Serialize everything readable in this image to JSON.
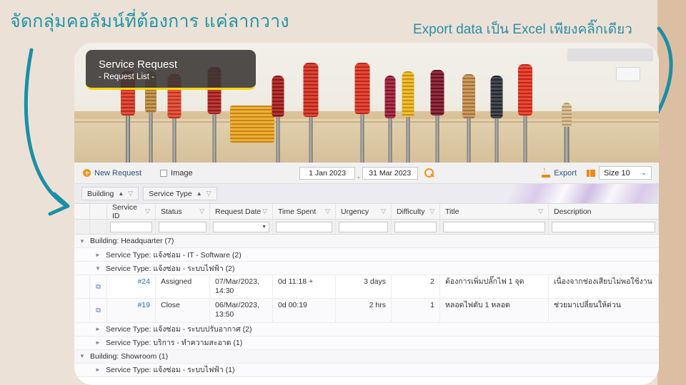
{
  "annotations": {
    "left_heading": "จัดกลุ่มคอลัมน์ที่ต้องการ แค่ลากวาง",
    "right_heading": "Export data เป็น Excel เพียงคลิ๊กเดียว",
    "accent_color": "#2196a8"
  },
  "hero": {
    "title": "Service Request",
    "subtitle": "- Request List -",
    "accent_underline": "#f5d60a"
  },
  "toolbar": {
    "new_request_label": "New Request",
    "new_request_icon": "plus-circle-icon",
    "image_checkbox_label": "Image",
    "image_checked": false,
    "date_from": "1 Jan 2023",
    "date_separator": "-",
    "date_to": "31 Mar 2023",
    "search_icon": "search-icon",
    "export_label": "Export",
    "export_icon": "export-icon",
    "size_icon": "list-size-icon",
    "size_value": "Size 10",
    "size_caret": "chevron-down-icon"
  },
  "group_chips": [
    {
      "label": "Building",
      "sort": "asc",
      "sort_icon": "sort-ascending-icon",
      "filter_icon": "filter-icon"
    },
    {
      "label": "Service Type",
      "sort": "asc",
      "sort_icon": "sort-ascending-icon",
      "filter_icon": "filter-icon"
    }
  ],
  "grid": {
    "columns": [
      {
        "label": "Service ID",
        "filter_icon": "filter-icon"
      },
      {
        "label": "Status",
        "filter_icon": "filter-icon"
      },
      {
        "label": "Request Date",
        "filter_icon": "filter-icon"
      },
      {
        "label": "Time Spent",
        "filter_icon": "filter-icon"
      },
      {
        "label": "Urgency",
        "filter_icon": "filter-icon"
      },
      {
        "label": "Difficulty",
        "filter_icon": "filter-icon"
      },
      {
        "label": "Title",
        "filter_icon": "filter-icon"
      },
      {
        "label": "Description",
        "filter_icon": ""
      }
    ],
    "filter_row": {
      "service_id": "",
      "status": "",
      "request_date": "",
      "time_spent": "",
      "urgency": "",
      "difficulty": "",
      "title": "",
      "description": ""
    },
    "groups": [
      {
        "level": 0,
        "expanded": true,
        "label": "Building: Headquarter (7)"
      },
      {
        "level": 1,
        "expanded": false,
        "label": "Service Type: แจ้งซ่อม - IT - Software (2)"
      },
      {
        "level": 1,
        "expanded": true,
        "label": "Service Type: แจ้งซ่อม - ระบบไฟฟ้า (2)"
      },
      {
        "level": 1,
        "expanded": false,
        "label": "Service Type: แจ้งซ่อม - ระบบปรับอากาศ (2)"
      },
      {
        "level": 1,
        "expanded": false,
        "label": "Service Type: บริการ - ทำความสะอาด (1)"
      },
      {
        "level": 0,
        "expanded": true,
        "label": "Building: Showroom (1)"
      },
      {
        "level": 1,
        "expanded": false,
        "label": "Service Type: แจ้งซ่อม - ระบบไฟฟ้า (1)"
      }
    ],
    "rows": [
      {
        "open_icon": "external-link-icon",
        "service_id": "#24",
        "status": "Assigned",
        "request_date": "07/Mar/2023, 14:30",
        "time_spent": "0d 11:18 +",
        "urgency": "3 days",
        "difficulty": "2",
        "title": "ต้องการเพิ่มปลั๊กไฟ 1 จุด",
        "description": "เนื่องจากช่องเสียบไม่พอใช้งาน"
      },
      {
        "open_icon": "external-link-icon",
        "service_id": "#19",
        "status": "Close",
        "request_date": "06/Mar/2023, 13:50",
        "time_spent": "0d 00:19",
        "urgency": "2 hrs",
        "difficulty": "1",
        "title": "หลอดไฟดับ 1 หลอด",
        "description": "ช่วยมาเปลี่ยนให้ด่วน"
      }
    ]
  }
}
